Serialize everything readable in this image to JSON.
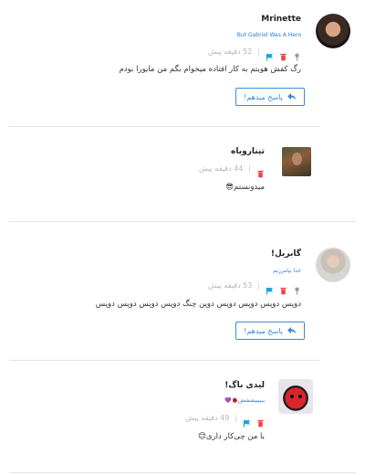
{
  "comments": [
    {
      "author": "Mrinette",
      "subtitle": "But Gabriel Was A Hero",
      "time": "52 دقیقه پیش",
      "text": "رگ کفش هویتم به کار افتاده میخوام بگم من مایورا بودم",
      "reply_label": "پاسخ میدهم!"
    },
    {
      "author": "تینارویاه",
      "time": "44 دقیقه پیش",
      "text": "میدونستم😎"
    },
    {
      "author": "گابریل!",
      "subtitle": "خدا بیامرزتم",
      "time": "53 دقیقه پیش",
      "text": "دوپس دوپس دوپس دوپس دوپن چنگ دوپس دوپس دوپس دوپس",
      "reply_label": "پاسخ میدهم!"
    },
    {
      "author": "لیدی باگ!",
      "subtitle": "ببییییششش🐞💜",
      "time": "49 دقیقه پیش",
      "text": "با من چی‌کار داری😊"
    }
  ],
  "colors": {
    "flag": "#1aa3d6",
    "trash": "#e44",
    "pin": "#999",
    "accent": "#3a8ad6"
  },
  "icons": [
    "pin-icon",
    "trash-icon",
    "flag-icon",
    "reply-icon"
  ]
}
